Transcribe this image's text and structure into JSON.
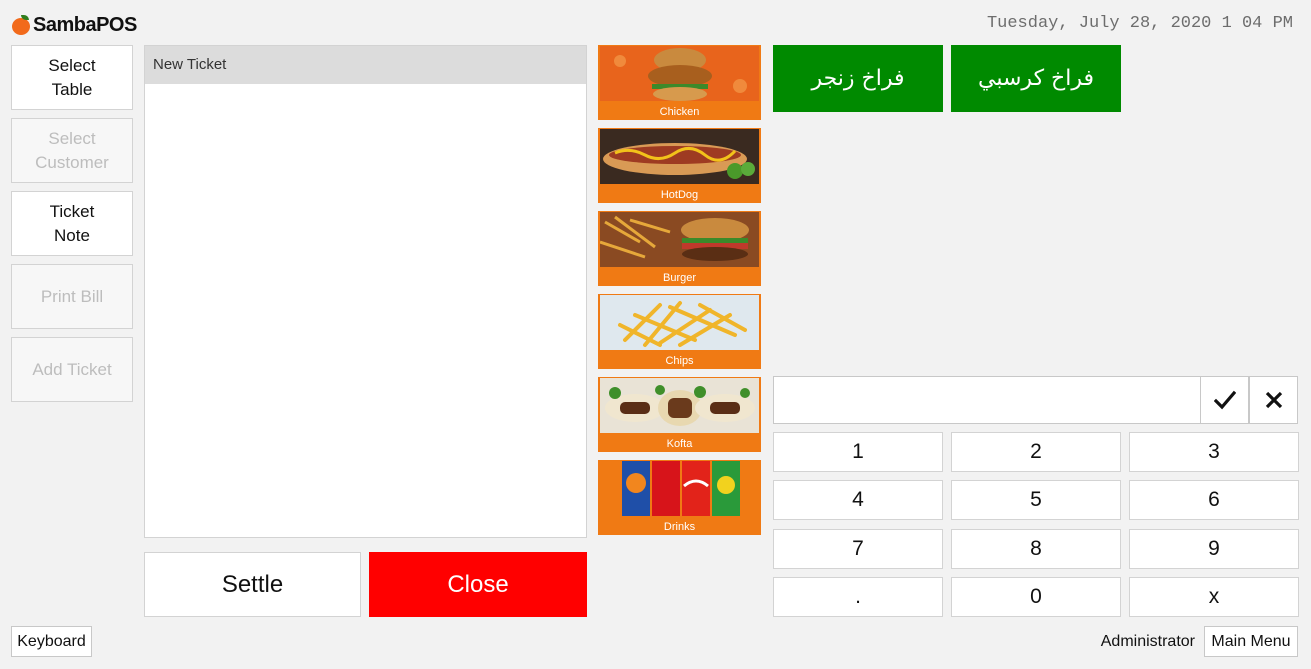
{
  "app": {
    "brand": "SambaPOS"
  },
  "header": {
    "datetime": "Tuesday, July 28, 2020 1 04 PM"
  },
  "left_actions": [
    {
      "label": "Select\nTable",
      "enabled": true
    },
    {
      "label": "Select\nCustomer",
      "enabled": false
    },
    {
      "label": "Ticket\nNote",
      "enabled": true
    },
    {
      "label": "Print Bill",
      "enabled": false
    },
    {
      "label": "Add Ticket",
      "enabled": false
    }
  ],
  "ticket": {
    "title": "New Ticket",
    "items": []
  },
  "ticket_actions": {
    "settle_label": "Settle",
    "close_label": "Close",
    "close_color": "#ff0000"
  },
  "categories": [
    {
      "label": "Chicken",
      "icon": "chicken-burger-image"
    },
    {
      "label": "HotDog",
      "icon": "hotdog-image"
    },
    {
      "label": "Burger",
      "icon": "burger-fries-image"
    },
    {
      "label": "Chips",
      "icon": "fries-image"
    },
    {
      "label": "Kofta",
      "icon": "kofta-image"
    },
    {
      "label": "Drinks",
      "icon": "soda-cans-image"
    }
  ],
  "products": [
    {
      "label": "فراخ زنجر",
      "color": "#008a00"
    },
    {
      "label": "فراخ كرسبي",
      "color": "#008a00"
    }
  ],
  "numpad": {
    "input_value": "",
    "confirm_icon": "checkmark-icon",
    "cancel_icon": "x-icon",
    "keys": [
      "1",
      "2",
      "3",
      "4",
      "5",
      "6",
      "7",
      "8",
      "9",
      ".",
      "0",
      "x"
    ]
  },
  "footer": {
    "keyboard_label": "Keyboard",
    "user": "Administrator",
    "main_menu_label": "Main Menu"
  },
  "colors": {
    "accent_category": "#f07a14",
    "product_green": "#008a00",
    "background": "#f2f2f2"
  }
}
